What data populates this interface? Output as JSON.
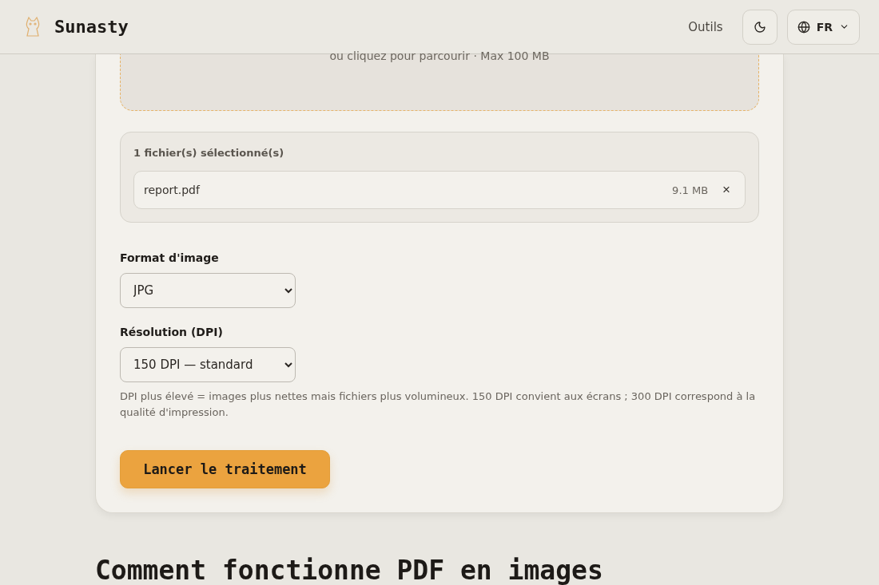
{
  "header": {
    "brand": "Sunasty",
    "nav_link": "Outils",
    "language": "FR"
  },
  "dropzone": {
    "hint": "ou cliquez pour parcourir · Max 100 MB"
  },
  "files": {
    "title": "1 fichier(s) sélectionné(s)",
    "items": [
      {
        "name": "report.pdf",
        "size": "9.1 MB",
        "remove": "×"
      }
    ]
  },
  "fields": [
    {
      "label": "Format d'image",
      "value": "JPG"
    },
    {
      "label": "Résolution (DPI)",
      "value": "150 DPI — standard"
    }
  ],
  "help": "DPI plus élevé = images plus nettes mais fichiers plus volumineux. 150 DPI convient aux écrans ; 300 DPI correspond à la qualité d'impression.",
  "submit": "Lancer le traitement",
  "section_heading": "Comment fonctionne PDF en images"
}
